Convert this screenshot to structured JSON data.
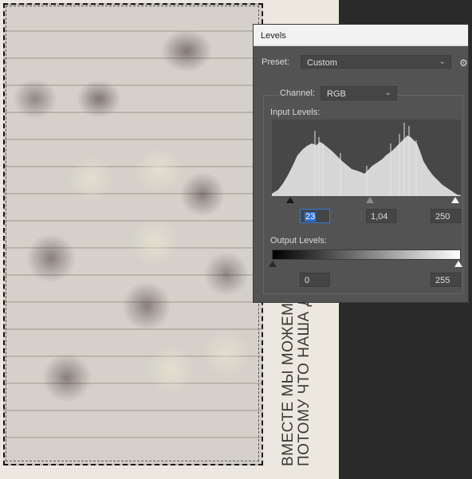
{
  "canvas": {
    "side_text_line1": "ВМЕСТЕ МЫ МОЖЕМ",
    "side_text_line2": "ПОТОМУ ЧТО НАША Д"
  },
  "levels": {
    "title": "Levels",
    "preset_label": "Preset:",
    "preset_value": "Custom",
    "channel_label": "Channel:",
    "channel_value": "RGB",
    "input_levels_label": "Input Levels:",
    "input_black": "23",
    "input_gamma": "1,04",
    "input_white": "250",
    "output_levels_label": "Output Levels:",
    "output_black": "0",
    "output_white": "255",
    "icons": {
      "dropdown": "chevron-down-icon",
      "settings": "gear-icon"
    }
  },
  "colors": {
    "panel_bg": "#535353",
    "histogram_bg": "#474747",
    "histogram_fill": "#d6d6d6",
    "field_focus": "#2f7bd8"
  }
}
